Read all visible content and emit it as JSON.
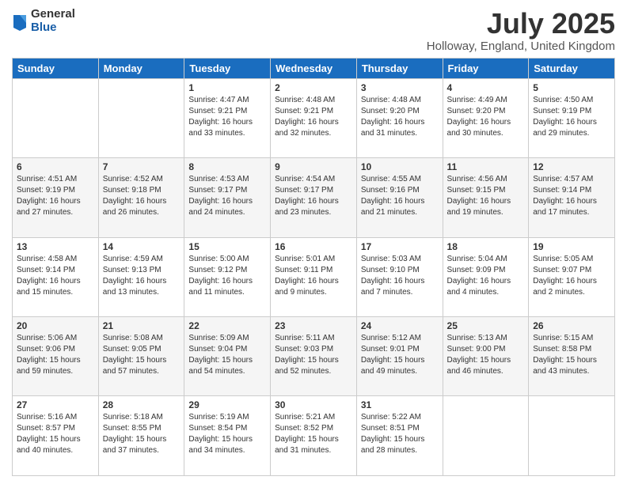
{
  "logo": {
    "general": "General",
    "blue": "Blue"
  },
  "title": "July 2025",
  "subtitle": "Holloway, England, United Kingdom",
  "headers": [
    "Sunday",
    "Monday",
    "Tuesday",
    "Wednesday",
    "Thursday",
    "Friday",
    "Saturday"
  ],
  "weeks": [
    [
      {
        "day": "",
        "info": ""
      },
      {
        "day": "",
        "info": ""
      },
      {
        "day": "1",
        "info": "Sunrise: 4:47 AM\nSunset: 9:21 PM\nDaylight: 16 hours\nand 33 minutes."
      },
      {
        "day": "2",
        "info": "Sunrise: 4:48 AM\nSunset: 9:21 PM\nDaylight: 16 hours\nand 32 minutes."
      },
      {
        "day": "3",
        "info": "Sunrise: 4:48 AM\nSunset: 9:20 PM\nDaylight: 16 hours\nand 31 minutes."
      },
      {
        "day": "4",
        "info": "Sunrise: 4:49 AM\nSunset: 9:20 PM\nDaylight: 16 hours\nand 30 minutes."
      },
      {
        "day": "5",
        "info": "Sunrise: 4:50 AM\nSunset: 9:19 PM\nDaylight: 16 hours\nand 29 minutes."
      }
    ],
    [
      {
        "day": "6",
        "info": "Sunrise: 4:51 AM\nSunset: 9:19 PM\nDaylight: 16 hours\nand 27 minutes."
      },
      {
        "day": "7",
        "info": "Sunrise: 4:52 AM\nSunset: 9:18 PM\nDaylight: 16 hours\nand 26 minutes."
      },
      {
        "day": "8",
        "info": "Sunrise: 4:53 AM\nSunset: 9:17 PM\nDaylight: 16 hours\nand 24 minutes."
      },
      {
        "day": "9",
        "info": "Sunrise: 4:54 AM\nSunset: 9:17 PM\nDaylight: 16 hours\nand 23 minutes."
      },
      {
        "day": "10",
        "info": "Sunrise: 4:55 AM\nSunset: 9:16 PM\nDaylight: 16 hours\nand 21 minutes."
      },
      {
        "day": "11",
        "info": "Sunrise: 4:56 AM\nSunset: 9:15 PM\nDaylight: 16 hours\nand 19 minutes."
      },
      {
        "day": "12",
        "info": "Sunrise: 4:57 AM\nSunset: 9:14 PM\nDaylight: 16 hours\nand 17 minutes."
      }
    ],
    [
      {
        "day": "13",
        "info": "Sunrise: 4:58 AM\nSunset: 9:14 PM\nDaylight: 16 hours\nand 15 minutes."
      },
      {
        "day": "14",
        "info": "Sunrise: 4:59 AM\nSunset: 9:13 PM\nDaylight: 16 hours\nand 13 minutes."
      },
      {
        "day": "15",
        "info": "Sunrise: 5:00 AM\nSunset: 9:12 PM\nDaylight: 16 hours\nand 11 minutes."
      },
      {
        "day": "16",
        "info": "Sunrise: 5:01 AM\nSunset: 9:11 PM\nDaylight: 16 hours\nand 9 minutes."
      },
      {
        "day": "17",
        "info": "Sunrise: 5:03 AM\nSunset: 9:10 PM\nDaylight: 16 hours\nand 7 minutes."
      },
      {
        "day": "18",
        "info": "Sunrise: 5:04 AM\nSunset: 9:09 PM\nDaylight: 16 hours\nand 4 minutes."
      },
      {
        "day": "19",
        "info": "Sunrise: 5:05 AM\nSunset: 9:07 PM\nDaylight: 16 hours\nand 2 minutes."
      }
    ],
    [
      {
        "day": "20",
        "info": "Sunrise: 5:06 AM\nSunset: 9:06 PM\nDaylight: 15 hours\nand 59 minutes."
      },
      {
        "day": "21",
        "info": "Sunrise: 5:08 AM\nSunset: 9:05 PM\nDaylight: 15 hours\nand 57 minutes."
      },
      {
        "day": "22",
        "info": "Sunrise: 5:09 AM\nSunset: 9:04 PM\nDaylight: 15 hours\nand 54 minutes."
      },
      {
        "day": "23",
        "info": "Sunrise: 5:11 AM\nSunset: 9:03 PM\nDaylight: 15 hours\nand 52 minutes."
      },
      {
        "day": "24",
        "info": "Sunrise: 5:12 AM\nSunset: 9:01 PM\nDaylight: 15 hours\nand 49 minutes."
      },
      {
        "day": "25",
        "info": "Sunrise: 5:13 AM\nSunset: 9:00 PM\nDaylight: 15 hours\nand 46 minutes."
      },
      {
        "day": "26",
        "info": "Sunrise: 5:15 AM\nSunset: 8:58 PM\nDaylight: 15 hours\nand 43 minutes."
      }
    ],
    [
      {
        "day": "27",
        "info": "Sunrise: 5:16 AM\nSunset: 8:57 PM\nDaylight: 15 hours\nand 40 minutes."
      },
      {
        "day": "28",
        "info": "Sunrise: 5:18 AM\nSunset: 8:55 PM\nDaylight: 15 hours\nand 37 minutes."
      },
      {
        "day": "29",
        "info": "Sunrise: 5:19 AM\nSunset: 8:54 PM\nDaylight: 15 hours\nand 34 minutes."
      },
      {
        "day": "30",
        "info": "Sunrise: 5:21 AM\nSunset: 8:52 PM\nDaylight: 15 hours\nand 31 minutes."
      },
      {
        "day": "31",
        "info": "Sunrise: 5:22 AM\nSunset: 8:51 PM\nDaylight: 15 hours\nand 28 minutes."
      },
      {
        "day": "",
        "info": ""
      },
      {
        "day": "",
        "info": ""
      }
    ]
  ]
}
